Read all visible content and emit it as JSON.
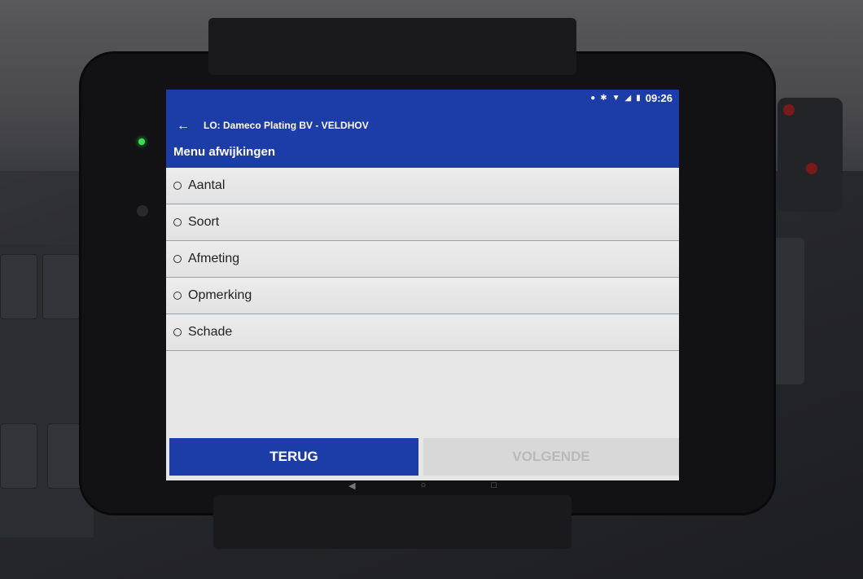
{
  "statusbar": {
    "icons": [
      "location-icon",
      "bluetooth-icon",
      "wifi-icon",
      "signal-icon",
      "battery-icon"
    ],
    "time": "09:26"
  },
  "appbar": {
    "back_icon": "arrow-left-icon",
    "title": "LO: Dameco Plating BV - VELDHOV",
    "page_title": "Menu afwijkingen"
  },
  "options": [
    {
      "label": "Aantal"
    },
    {
      "label": "Soort"
    },
    {
      "label": "Afmeting"
    },
    {
      "label": "Opmerking"
    },
    {
      "label": "Schade"
    }
  ],
  "buttons": {
    "back_label": "TERUG",
    "next_label": "VOLGENDE"
  },
  "colors": {
    "primary": "#1c3ca8",
    "disabled_bg": "#d8d8d8",
    "disabled_text": "#b9b9b9"
  }
}
